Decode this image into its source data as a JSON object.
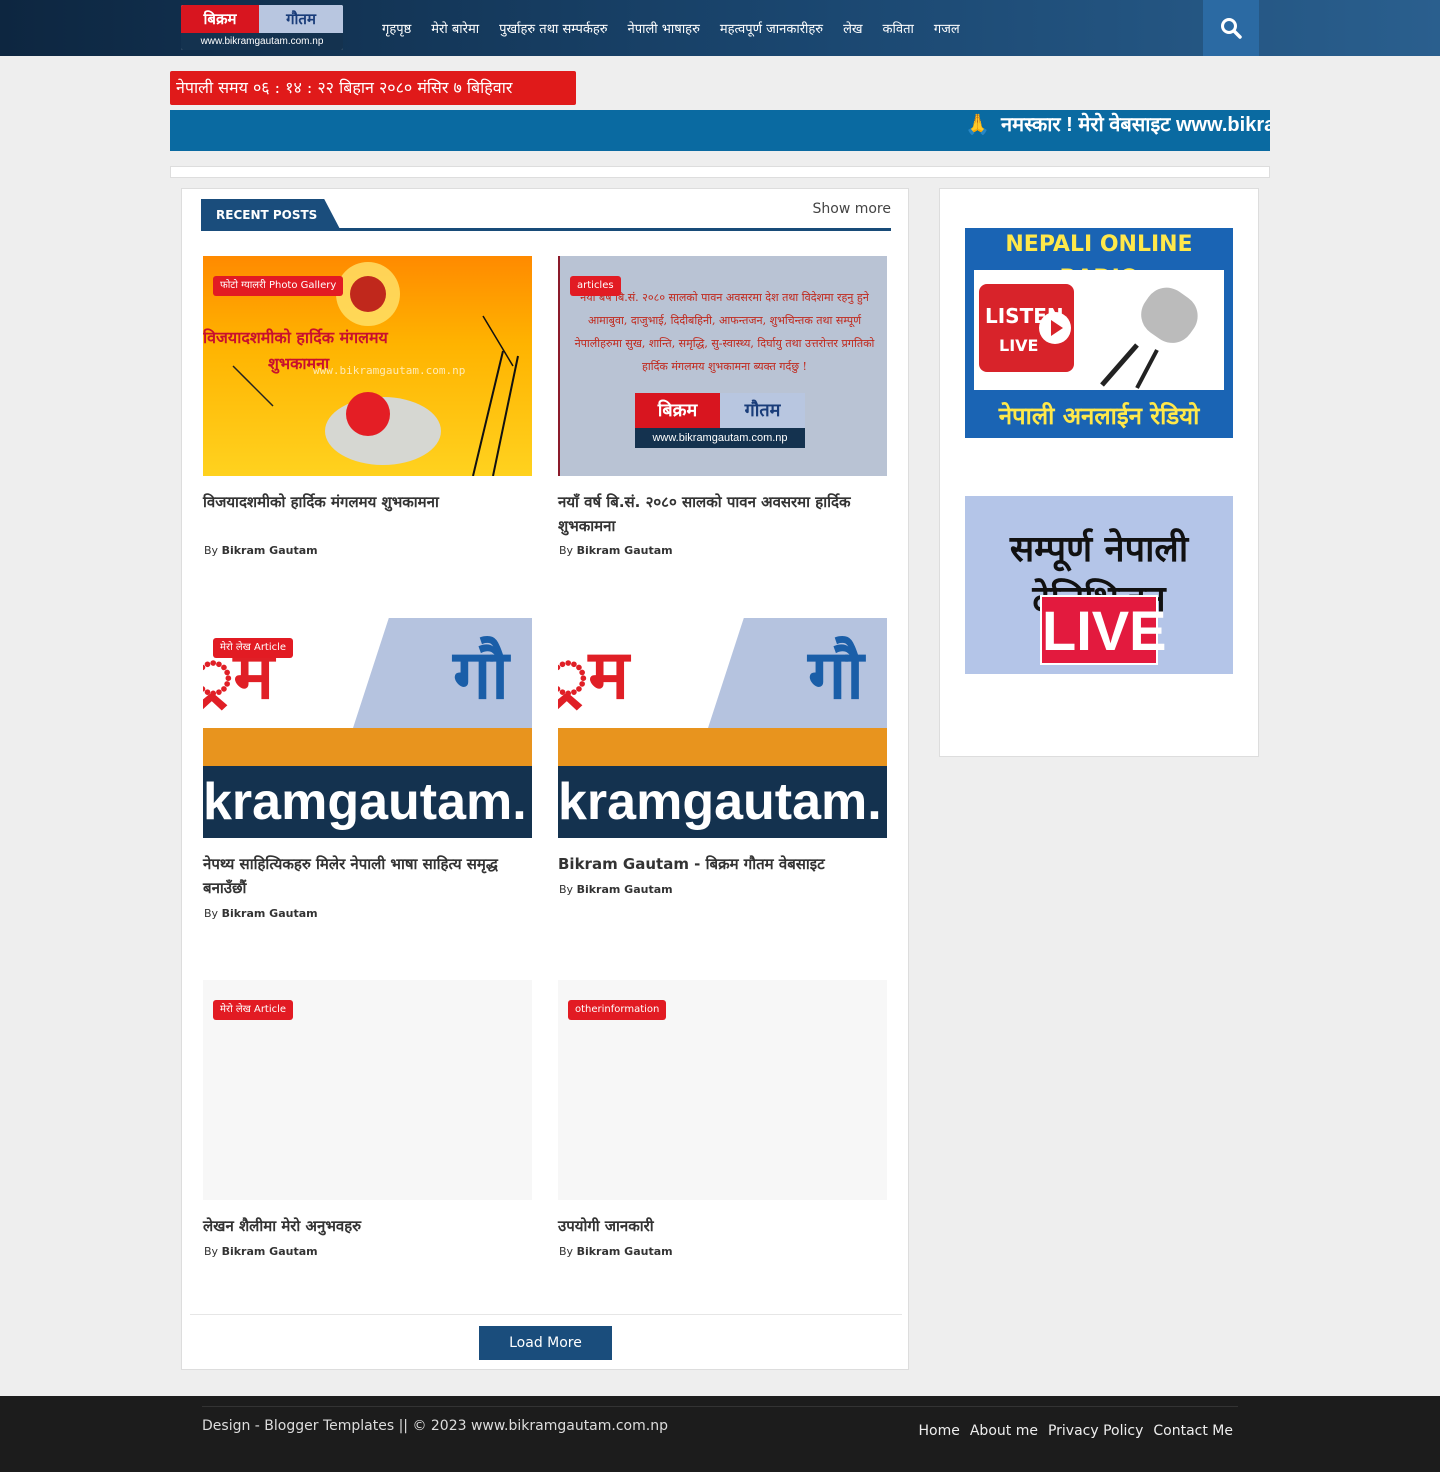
{
  "header": {
    "logo_top_left": "बिक्रम",
    "logo_top_right": "गौतम",
    "logo_url": "www.bikramgautam.com.np",
    "nav": [
      "गृहपृष्ठ",
      "मेरो बारेमा",
      "पुर्खाहरु तथा सम्पर्कहरु",
      "नेपाली भाषाहरु",
      "महत्वपूर्ण जानकारीहरु",
      "लेख",
      "कविता",
      "गजल"
    ],
    "search_icon": "search-icon"
  },
  "clock": {
    "text": "नेपाली समय ०६ : १४ : २२ बिहान   २०८० मंसिर ७ बिहिवार"
  },
  "marquee": {
    "icon": "🙏",
    "text": "नमस्कार ! मेरो वेबसाइट www.bikramgautam.com.np मा यहाँलाई हार्दिक स्वागत छ"
  },
  "recent": {
    "heading": "RECENT POSTS",
    "show_more": "Show more",
    "load_more": "Load More",
    "posts": [
      {
        "tag": "फोटो ग्यालरी Photo Gallery",
        "title": "विजयादशमीको हार्दिक मंगलमय शुभकामना",
        "by": "By",
        "author": "Bikram Gautam",
        "img_line1": "विजयादशमीको हार्दिक मंगलमय",
        "img_line2": "शुभकामना",
        "img_watermark": "www.bikramgautam.com.np"
      },
      {
        "tag": "articles",
        "title": "नयाँ वर्ष बि.सं. २०८० सालको पावन अवसरमा हार्दिक शुभकामना",
        "by": "By",
        "author": "Bikram Gautam",
        "img_text": "नयाँ बर्ष बि.सं. २०८० सालको पावन अवसरमा देश तथा विदेशमा रहनु हुने आमाबुवा, दाजुभाई, दिदीबहिनी, आफन्तजन, शुभचिन्तक तथा सम्पूर्ण नेपालीहरुमा सुख, शान्ति, समृद्धि, सु-स्वास्थ्य, दिर्घायु तथा उत्तरोत्तर प्रगतिको हार्दिक मंगलमय शुभकामना ब्यक्त गर्दछु !"
      },
      {
        "tag": "मेरो लेख Article",
        "title": "नेपथ्य साहित्यिकहरु मिलेर नेपाली भाषा साहित्य समृद्ध बनाउँछौं",
        "by": "By",
        "author": "Bikram Gautam",
        "img_red": "्रम",
        "img_blue": "गौ",
        "img_url": "kramgautam."
      },
      {
        "tag": "",
        "title": "Bikram Gautam - बिक्रम गौतम वेबसाइट",
        "by": "By",
        "author": "Bikram Gautam",
        "img_red": "्रम",
        "img_blue": "गौ",
        "img_url": "kramgautam."
      },
      {
        "tag": "मेरो लेख Article",
        "title": "लेखन शैलीमा मेरो अनुभवहरु",
        "by": "By",
        "author": "Bikram Gautam"
      },
      {
        "tag": "otherinformation",
        "title": "उपयोगी जानकारी",
        "by": "By",
        "author": "Bikram Gautam"
      }
    ]
  },
  "sidebar": {
    "radio": {
      "title": "NEPALI ONLINE RADIO",
      "listen": "LISTEN",
      "live": "LIVE",
      "bottom": "नेपाली अनलाईन रेडियो"
    },
    "tv": {
      "title": "सम्पूर्ण नेपाली टेलिभिजन",
      "live": "LIVE"
    }
  },
  "footer": {
    "copyright": "Design - Blogger Templates || © 2023 www.bikramgautam.com.np",
    "links": [
      "Home",
      "About me",
      "Privacy Policy",
      "Contact Me"
    ]
  },
  "colors": {
    "topbar": "#0d2640",
    "accent_red": "#e21b23",
    "section_blue": "#1a4d7c",
    "marquee_blue": "#0a6aa1",
    "footer": "#1c1c1c"
  }
}
